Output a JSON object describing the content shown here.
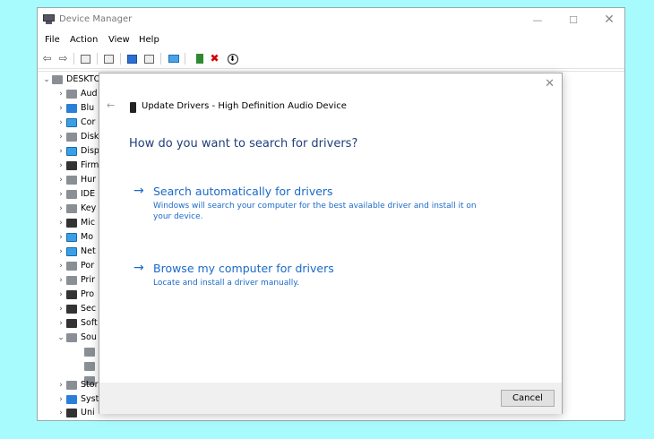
{
  "window": {
    "title": "Device Manager",
    "minimize_glyph": "—",
    "maximize_glyph": "☐",
    "close_glyph": "✕"
  },
  "menu": {
    "file": "File",
    "action": "Action",
    "view": "View",
    "help": "Help"
  },
  "toolbar": {
    "back_glyph": "⇦",
    "forward_glyph": "⇨",
    "remove_glyph": "✖",
    "download_glyph": "⬇"
  },
  "tree": {
    "root": "DESKTO",
    "items": [
      {
        "label": "Aud"
      },
      {
        "label": "Blu"
      },
      {
        "label": "Cor"
      },
      {
        "label": "Disk"
      },
      {
        "label": "Disp"
      },
      {
        "label": "Firm"
      },
      {
        "label": "Hur"
      },
      {
        "label": "IDE"
      },
      {
        "label": "Key"
      },
      {
        "label": "Mic"
      },
      {
        "label": "Mo"
      },
      {
        "label": "Net"
      },
      {
        "label": "Por"
      },
      {
        "label": "Prir"
      },
      {
        "label": "Pro"
      },
      {
        "label": "Sec"
      },
      {
        "label": "Soft"
      },
      {
        "label": "Sou"
      },
      {
        "label": "Stor"
      },
      {
        "label": "Syst"
      },
      {
        "label": "Uni"
      }
    ]
  },
  "dialog": {
    "close_glyph": "✕",
    "back_glyph": "←",
    "title": "Update Drivers - High Definition Audio Device",
    "question": "How do you want to search for drivers?",
    "options": [
      {
        "arrow": "→",
        "title": "Search automatically for drivers",
        "description": "Windows will search your computer for the best available driver and install it on your device."
      },
      {
        "arrow": "→",
        "title": "Browse my computer for drivers",
        "description": "Locate and install a driver manually."
      }
    ],
    "cancel_label": "Cancel"
  },
  "colors": {
    "desktop_background": "#a8fbfd",
    "link_blue": "#1b6ac9",
    "heading_blue": "#1e3f7a"
  }
}
